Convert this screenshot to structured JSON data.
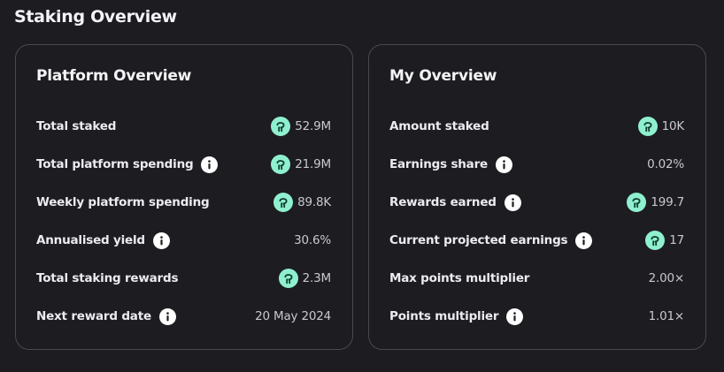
{
  "page": {
    "title": "Staking Overview"
  },
  "platform": {
    "title": "Platform Overview",
    "rows": [
      {
        "label": "Total staked",
        "value": "52.9M"
      },
      {
        "label": "Total platform spending",
        "value": "21.9M"
      },
      {
        "label": "Weekly platform spending",
        "value": "89.8K"
      },
      {
        "label": "Annualised yield",
        "value": "30.6%"
      },
      {
        "label": "Total staking rewards",
        "value": "2.3M"
      },
      {
        "label": "Next reward date",
        "value": "20 May 2024"
      }
    ]
  },
  "mine": {
    "title": "My Overview",
    "rows": [
      {
        "label": "Amount staked",
        "value": "10K"
      },
      {
        "label": "Earnings share",
        "value": "0.02%"
      },
      {
        "label": "Rewards earned",
        "value": "199.7"
      },
      {
        "label": "Current projected earnings",
        "value": "17"
      },
      {
        "label": "Max points multiplier",
        "value": "2.00×"
      },
      {
        "label": "Points multiplier",
        "value": "1.01×"
      }
    ]
  },
  "icons": {
    "info": "info-icon",
    "token": "token-icon"
  },
  "colors": {
    "background": "#1d1c21",
    "card_border": "#4a4950",
    "token_bg": "#8ff0cf",
    "token_fg": "#0f3d2f",
    "label": "#ececf0",
    "value": "#c9c8cf"
  }
}
